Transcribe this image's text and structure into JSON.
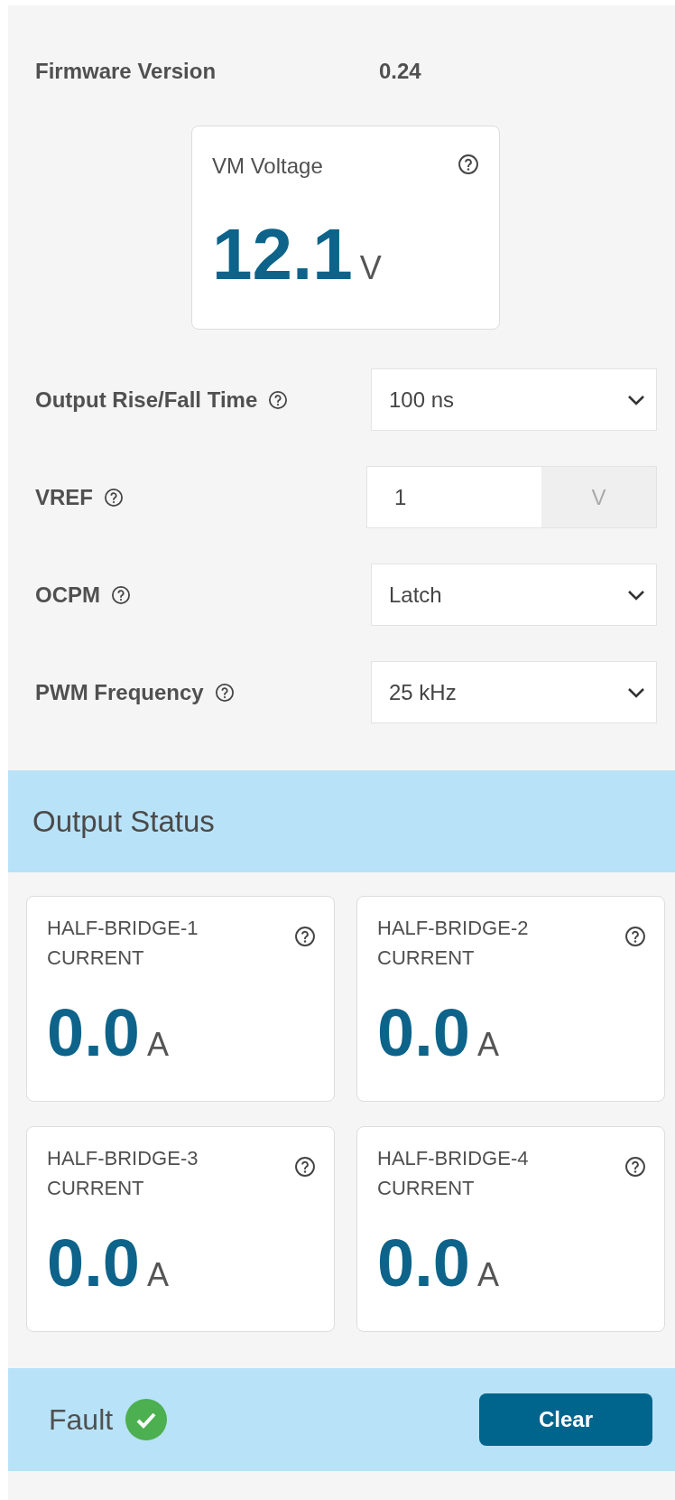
{
  "firmware": {
    "label": "Firmware Version",
    "value": "0.24"
  },
  "vm_card": {
    "title": "VM Voltage",
    "value": "12.1",
    "unit": "V"
  },
  "settings": [
    {
      "kind": "select",
      "label": "Output Rise/Fall Time",
      "value": "100 ns"
    },
    {
      "kind": "number",
      "label": "VREF",
      "value": "1",
      "unit": "V"
    },
    {
      "kind": "select",
      "label": "OCPM",
      "value": "Latch"
    },
    {
      "kind": "select",
      "label": "PWM Frequency",
      "value": "25 kHz"
    }
  ],
  "output_status": {
    "title": "Output Status",
    "cards": [
      {
        "title": "HALF-BRIDGE-1 CURRENT",
        "value": "0.0",
        "unit": "A"
      },
      {
        "title": "HALF-BRIDGE-2 CURRENT",
        "value": "0.0",
        "unit": "A"
      },
      {
        "title": "HALF-BRIDGE-3 CURRENT",
        "value": "0.0",
        "unit": "A"
      },
      {
        "title": "HALF-BRIDGE-4 CURRENT",
        "value": "0.0",
        "unit": "A"
      }
    ]
  },
  "fault": {
    "label": "Fault",
    "ok": true,
    "button": "Clear"
  }
}
